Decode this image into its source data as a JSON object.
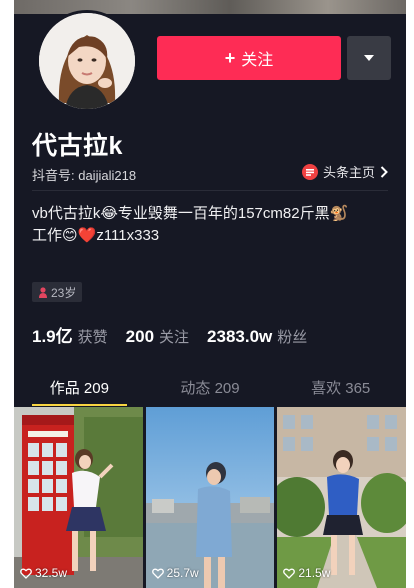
{
  "profile": {
    "follow_label": "关注",
    "nickname": "代古拉k",
    "douyin_id_label": "抖音号: daijiali218",
    "toutiao_label": "头条主页",
    "bio_line1": "vb代古拉k😂专业毁舞一百年的157cm82斤黑🐒",
    "bio_line2": "工作😊❤️z111x333",
    "age_label": "23岁"
  },
  "stats": [
    {
      "value": "1.9亿",
      "label": "获赞"
    },
    {
      "value": "200",
      "label": "关注"
    },
    {
      "value": "2383.0w",
      "label": "粉丝"
    }
  ],
  "tabs": [
    {
      "label": "作品 209"
    },
    {
      "label": "动态 209"
    },
    {
      "label": "喜欢 365"
    }
  ],
  "videos": [
    {
      "likes": "32.5w",
      "scene": "red-phone-booth"
    },
    {
      "likes": "25.7w",
      "scene": "waterfront"
    },
    {
      "likes": "21.5w",
      "scene": "park-path"
    }
  ],
  "colors": {
    "background": "#161824",
    "follow_button": "#fe2c55",
    "active_tab_indicator": "#f8d542"
  },
  "icons": [
    "plus-icon",
    "caret-down-icon",
    "toutiao-logo-icon",
    "chevron-right-icon",
    "female-icon",
    "heart-outline-icon"
  ]
}
